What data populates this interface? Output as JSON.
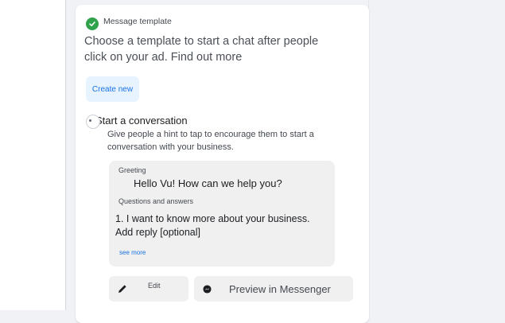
{
  "header": {
    "title": "Message template",
    "icon": "check-circle-icon",
    "icon_color": "#31a24c"
  },
  "description": "Choose a template to start a chat after people click on your ad. Find out more",
  "create_button": {
    "label": "Create new"
  },
  "conversation_option": {
    "title": "Start a conversation",
    "description": "Give people a hint to tap to encourage them to start a conversation with your business."
  },
  "preview": {
    "greeting_label": "Greeting",
    "greeting_text": "Hello Vu! How can we help you?",
    "qa_label": "Questions and answers",
    "qa_items": [
      "1. I want to know more about your business. Add reply [optional]"
    ],
    "see_more": "see more"
  },
  "actions": {
    "edit_label": "Edit",
    "preview_label": "Preview in Messenger"
  },
  "colors": {
    "accent": "#1b74e4",
    "button_bg": "#e7f3ff",
    "preview_bg": "#f0f0f0"
  }
}
